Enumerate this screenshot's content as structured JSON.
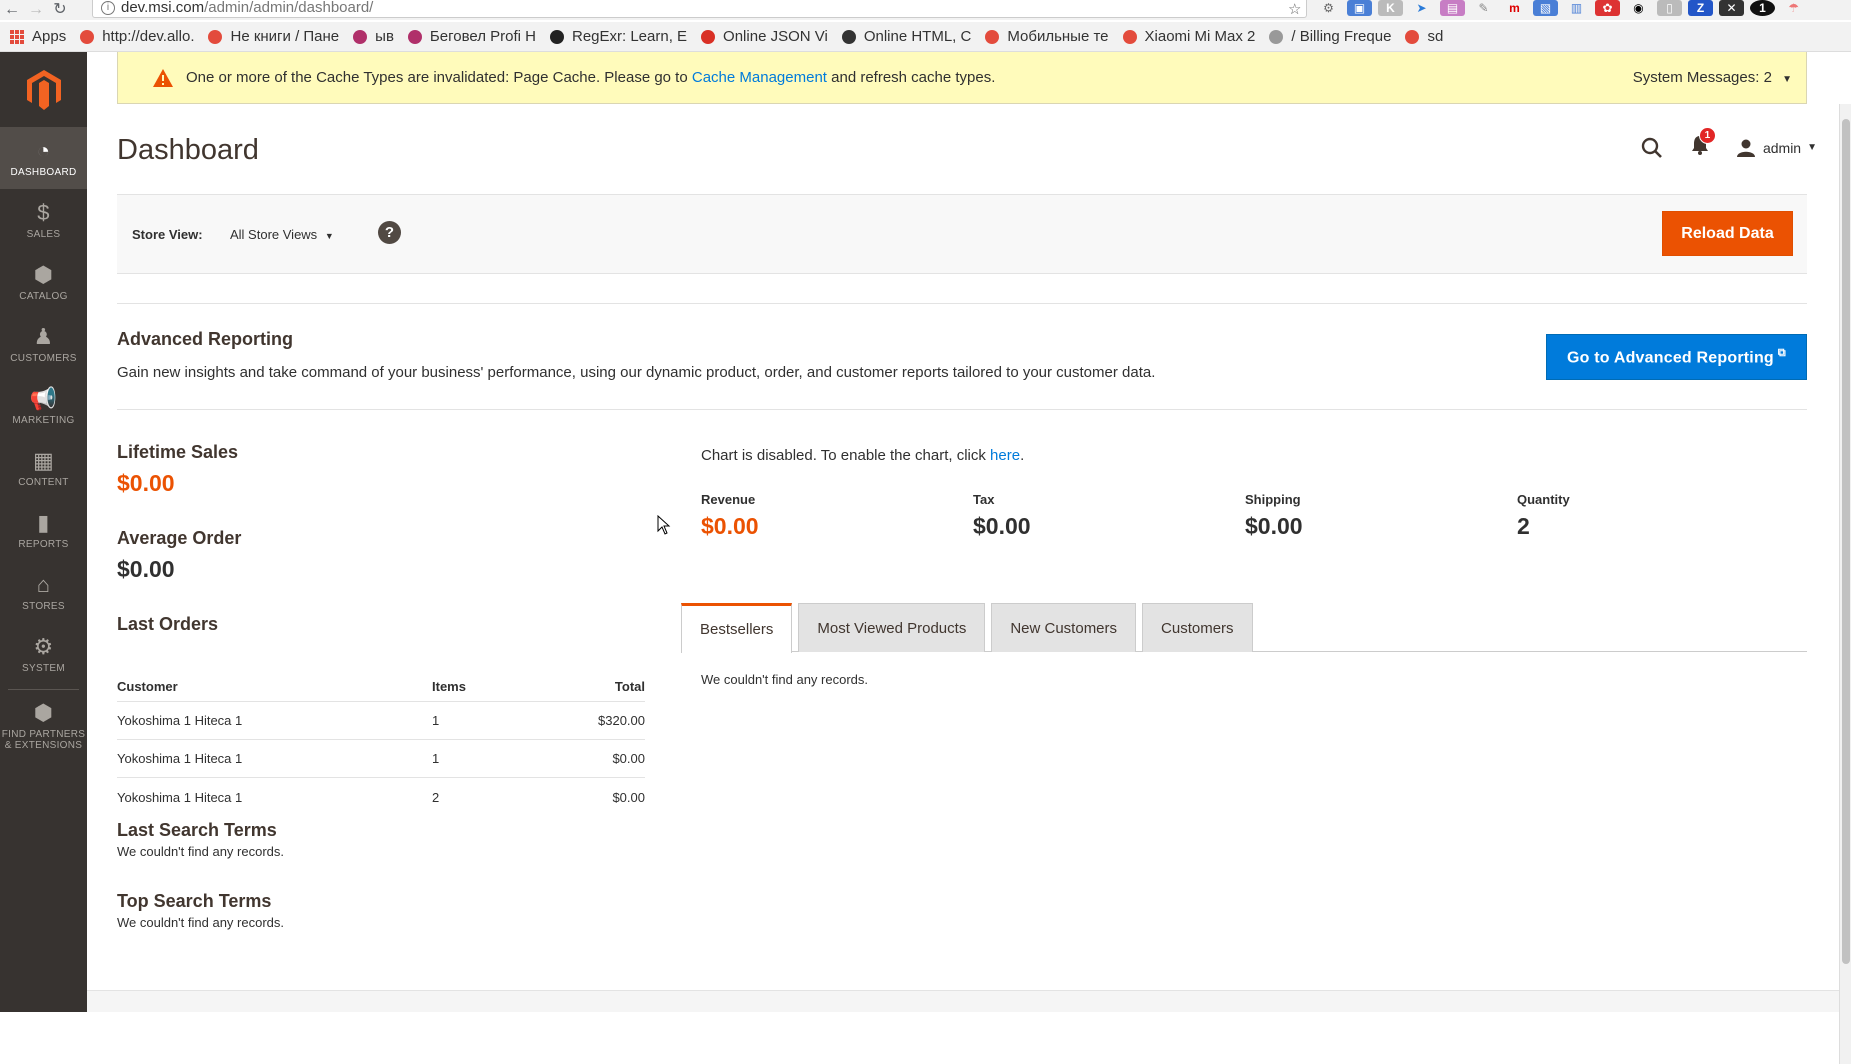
{
  "browser": {
    "url_host": "dev.msi.com",
    "url_path": "/admin/admin/dashboard/",
    "bookmarks": [
      {
        "label": "Apps",
        "color": "#e34b3c"
      },
      {
        "label": "http://dev.allo.",
        "color": "#e34b3c"
      },
      {
        "label": "Не книги / Пане",
        "color": "#e34b3c"
      },
      {
        "label": "ыв",
        "color": "#b0306a"
      },
      {
        "label": "Беговел Profi H",
        "color": "#b0306a"
      },
      {
        "label": "RegExr: Learn, E",
        "color": "#222222"
      },
      {
        "label": "Online JSON Vi",
        "color": "#d93025"
      },
      {
        "label": "Online HTML, C",
        "color": "#333333"
      },
      {
        "label": "Мобильные те",
        "color": "#e34b3c"
      },
      {
        "label": "Xiaomi Mi Max 2",
        "color": "#e34b3c"
      },
      {
        "label": "/ Billing Freque",
        "color": "#999999"
      },
      {
        "label": "sd",
        "color": "#e34b3c"
      }
    ]
  },
  "sidebar": {
    "items": [
      {
        "label": "DASHBOARD",
        "icon": "dashboard-icon",
        "glyph": "◔"
      },
      {
        "label": "SALES",
        "icon": "dollar-icon",
        "glyph": "$"
      },
      {
        "label": "CATALOG",
        "icon": "box-icon",
        "glyph": "⬢"
      },
      {
        "label": "CUSTOMERS",
        "icon": "person-icon",
        "glyph": "♟"
      },
      {
        "label": "MARKETING",
        "icon": "megaphone-icon",
        "glyph": "📢"
      },
      {
        "label": "CONTENT",
        "icon": "layout-icon",
        "glyph": "▦"
      },
      {
        "label": "REPORTS",
        "icon": "bar-chart-icon",
        "glyph": "▮"
      },
      {
        "label": "STORES",
        "icon": "store-icon",
        "glyph": "⌂"
      },
      {
        "label": "SYSTEM",
        "icon": "gear-icon",
        "glyph": "⚙"
      },
      {
        "label": "FIND PARTNERS & EXTENSIONS",
        "icon": "extensions-icon",
        "glyph": "⬢"
      }
    ]
  },
  "system_message": {
    "text_before": "One or more of the Cache Types are invalidated: Page Cache. Please go to ",
    "link": "Cache Management",
    "text_after": " and refresh cache types.",
    "count_label": "System Messages: 2"
  },
  "header": {
    "title": "Dashboard",
    "notification_count": "1",
    "user": "admin"
  },
  "store_switcher": {
    "label": "Store View:",
    "value": "All Store Views",
    "help": "?",
    "reload_button": "Reload Data"
  },
  "advanced_reporting": {
    "title": "Advanced Reporting",
    "description": "Gain new insights and take command of your business' performance, using our dynamic product, order, and customer reports tailored to your customer data.",
    "button": "Go to Advanced Reporting"
  },
  "stats": {
    "lifetime_sales_label": "Lifetime Sales",
    "lifetime_sales_value": "$0.00",
    "average_order_label": "Average Order",
    "average_order_value": "$0.00"
  },
  "last_orders": {
    "title": "Last Orders",
    "columns": [
      "Customer",
      "Items",
      "Total"
    ],
    "rows": [
      [
        "Yokoshima 1 Hiteca 1",
        "1",
        "$320.00"
      ],
      [
        "Yokoshima 1 Hiteca 1",
        "1",
        "$0.00"
      ],
      [
        "Yokoshima 1 Hiteca 1",
        "2",
        "$0.00"
      ]
    ]
  },
  "last_search_terms": {
    "title": "Last Search Terms",
    "empty": "We couldn't find any records."
  },
  "top_search_terms": {
    "title": "Top Search Terms",
    "empty": "We couldn't find any records."
  },
  "chart": {
    "message_before": "Chart is disabled. To enable the chart, click ",
    "link": "here",
    "message_after": "."
  },
  "totals": [
    {
      "label": "Revenue",
      "value": "$0.00"
    },
    {
      "label": "Tax",
      "value": "$0.00"
    },
    {
      "label": "Shipping",
      "value": "$0.00"
    },
    {
      "label": "Quantity",
      "value": "2"
    }
  ],
  "tabs": {
    "items": [
      "Bestsellers",
      "Most Viewed Products",
      "New Customers",
      "Customers"
    ],
    "active": "Bestsellers",
    "empty": "We couldn't find any records."
  },
  "colors": {
    "accent": "#eb5202",
    "link": "#007bdb",
    "sidebar": "#373330"
  }
}
